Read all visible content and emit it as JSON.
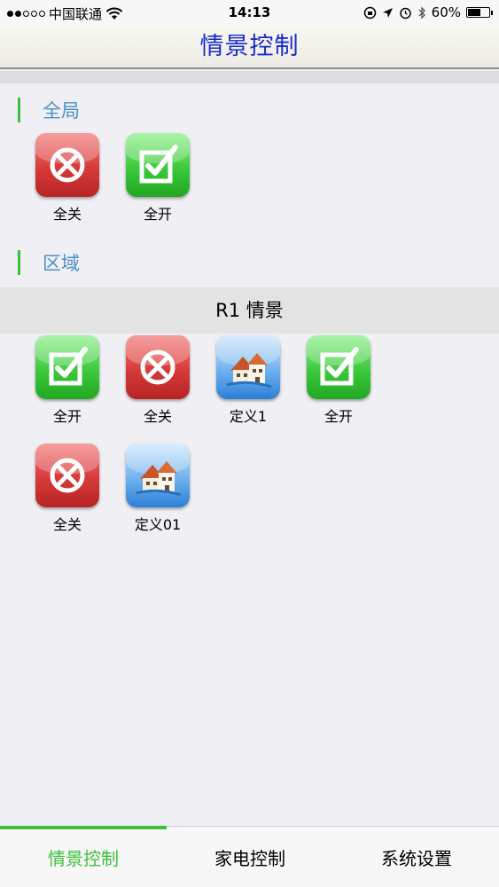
{
  "status_bar": {
    "carrier": "中国联通",
    "time": "14:13",
    "battery": "60%",
    "battery_level": 0.6
  },
  "nav": {
    "title": "情景控制"
  },
  "global_section": {
    "title": "全局",
    "tiles": [
      {
        "label": "全关",
        "type": "off"
      },
      {
        "label": "全开",
        "type": "on"
      }
    ]
  },
  "area_section": {
    "title": "区域",
    "area_name": "R1 情景",
    "tiles": [
      {
        "label": "全开",
        "type": "on"
      },
      {
        "label": "全关",
        "type": "off"
      },
      {
        "label": "定义1",
        "type": "custom"
      },
      {
        "label": "全开",
        "type": "on"
      },
      {
        "label": "全关",
        "type": "off"
      },
      {
        "label": "定义01",
        "type": "custom"
      }
    ]
  },
  "tab_bar": {
    "tabs": [
      {
        "label": "情景控制",
        "active": true
      },
      {
        "label": "家电控制",
        "active": false
      },
      {
        "label": "系统设置",
        "active": false
      }
    ]
  },
  "colors": {
    "accent_green": "#3cbf3c",
    "title_blue": "#1a2ad0",
    "section_blue": "#4a90c8"
  }
}
